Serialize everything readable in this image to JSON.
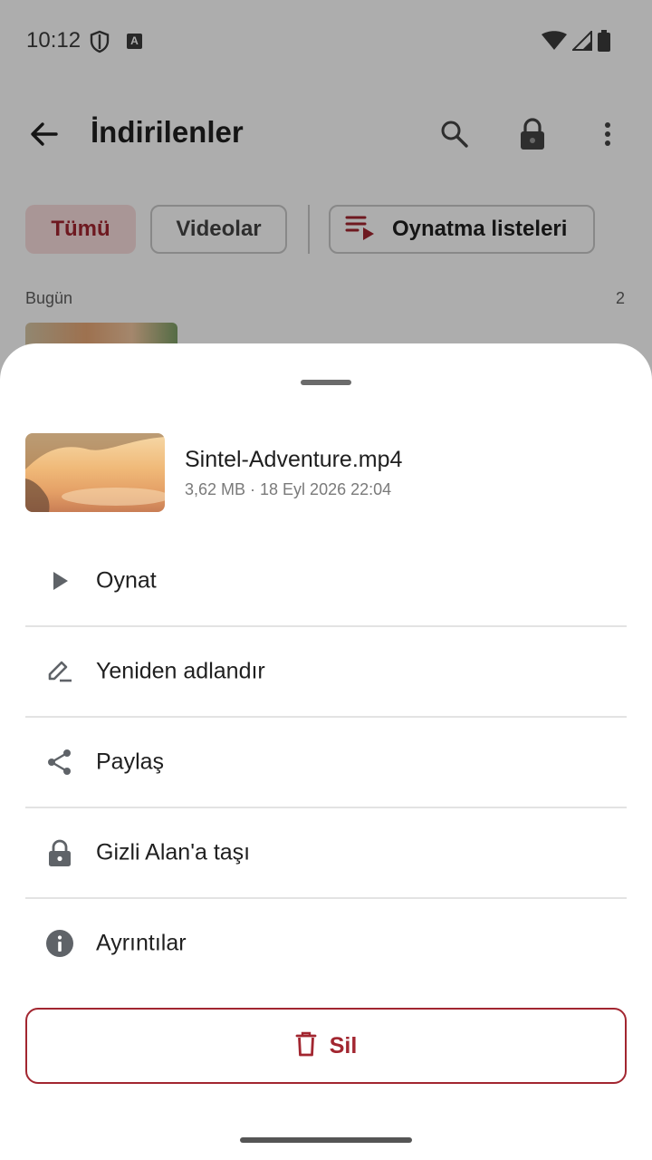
{
  "status_bar": {
    "time": "10:12",
    "badge_letter": "A"
  },
  "app_bar": {
    "title": "İndirilenler"
  },
  "filters": {
    "all": "Tümü",
    "videos": "Videolar",
    "playlists": "Oynatma listeleri"
  },
  "section": {
    "label": "Bugün",
    "count": "2"
  },
  "sheet": {
    "file": {
      "name": "Sintel-Adventure.mp4",
      "meta": "3,62 MB · 18 Eyl 2026 22:04"
    },
    "menu": [
      {
        "label": "Oynat",
        "icon": "play-icon"
      },
      {
        "label": "Yeniden adlandır",
        "icon": "rename-icon"
      },
      {
        "label": "Paylaş",
        "icon": "share-icon"
      },
      {
        "label": "Gizli Alan'a taşı",
        "icon": "lock-icon"
      },
      {
        "label": "Ayrıntılar",
        "icon": "info-icon"
      }
    ],
    "delete_label": "Sil"
  },
  "colors": {
    "accent": "#a22630",
    "chip_selected_bg": "#f9dede",
    "icon_gray": "#5f6368",
    "scrim": "rgba(0,0,0,0.32)"
  }
}
